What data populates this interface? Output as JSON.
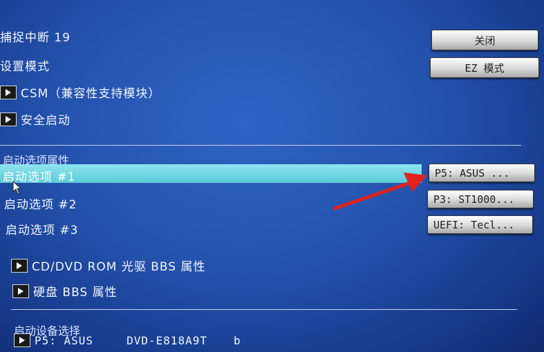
{
  "top": {
    "intercept_line": "捕捉中断 19",
    "setup_mode": "设置模式"
  },
  "buttons": {
    "close": "关闭",
    "ez_mode": "EZ 模式"
  },
  "submenus": {
    "csm": "CSM（兼容性支持模块）",
    "secure_boot": "安全启动",
    "cd_dvd": "CD/DVD ROM 光驱 BBS 属性",
    "hdd": "硬盘 BBS 属性"
  },
  "boot_options": {
    "heading": "启动选项属性",
    "items": [
      {
        "label": "启动选项 #1",
        "value": "P5: ASUS   ..."
      },
      {
        "label": "启动选项 #2",
        "value": "P3: ST1000..."
      },
      {
        "label": "启动选项 #3",
        "value": "UEFI: Tecl..."
      }
    ]
  },
  "boot_device": {
    "heading": "启动设备选择",
    "port": "P5: ASUS",
    "model": "DVD-E818A9T",
    "suffix": "b"
  },
  "colors": {
    "background": "#2453ad",
    "highlight": "#6fd3df",
    "arrow": "#e0221e"
  }
}
